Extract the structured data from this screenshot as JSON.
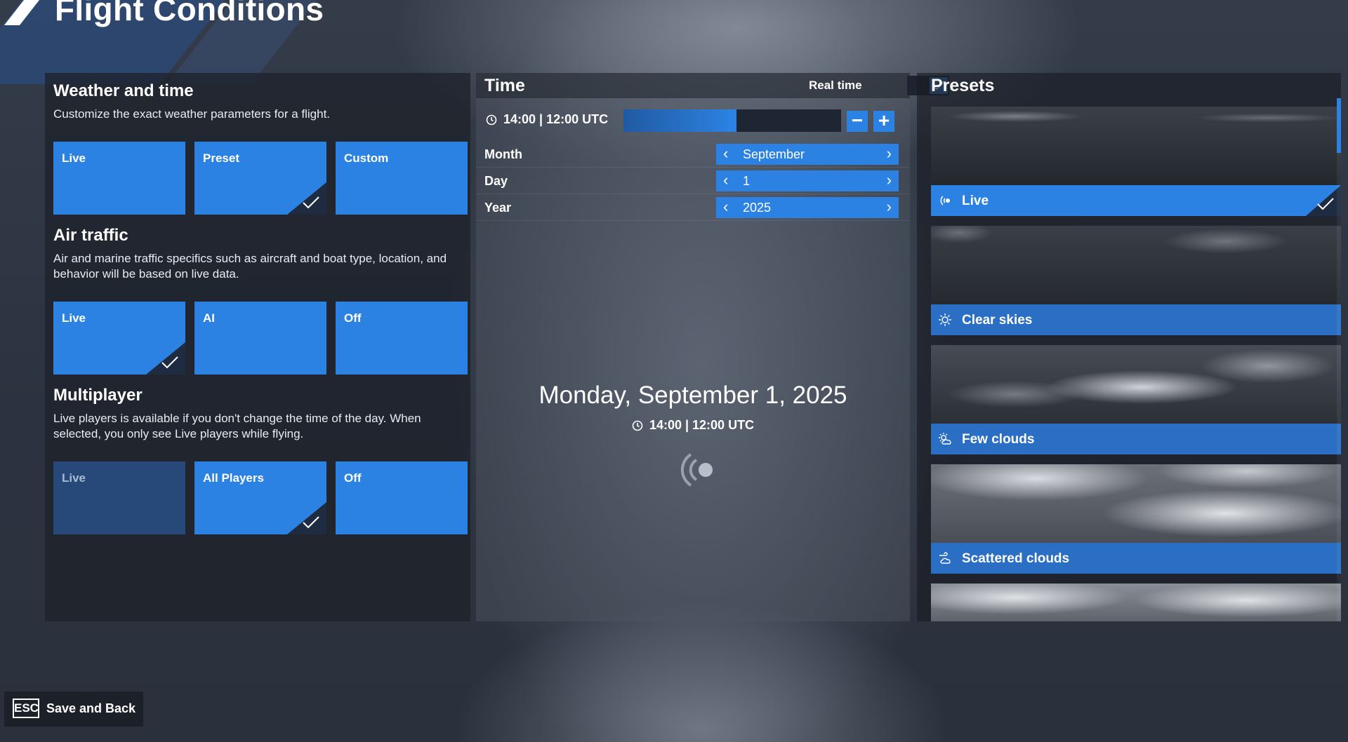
{
  "header": {
    "title": "Flight Conditions"
  },
  "weather": {
    "title": "Weather and time",
    "desc": "Customize the exact weather parameters for a flight.",
    "options": [
      {
        "label": "Live",
        "selected": false
      },
      {
        "label": "Preset",
        "selected": true
      },
      {
        "label": "Custom",
        "selected": false
      }
    ]
  },
  "air_traffic": {
    "title": "Air traffic",
    "desc": "Air and marine traffic specifics such as aircraft and boat type, location, and behavior will be based on live data.",
    "options": [
      {
        "label": "Live",
        "selected": true
      },
      {
        "label": "AI",
        "selected": false
      },
      {
        "label": "Off",
        "selected": false
      }
    ]
  },
  "multiplayer": {
    "title": "Multiplayer",
    "desc": "Live players is available if you don't change the time of the day. When selected, you only see Live players while flying.",
    "options": [
      {
        "label": "Live",
        "selected": false,
        "disabled": true
      },
      {
        "label": "All Players",
        "selected": true
      },
      {
        "label": "Off",
        "selected": false
      }
    ]
  },
  "time": {
    "title": "Time",
    "realtime_label": "Real time",
    "realtime_checked": true,
    "current": "14:00 | 12:00 UTC",
    "slider_fraction": 0.5,
    "minus": "−",
    "plus": "+",
    "rows": [
      {
        "label": "Month",
        "value": "September"
      },
      {
        "label": "Day",
        "value": "1"
      },
      {
        "label": "Year",
        "value": "2025"
      }
    ],
    "full_date": "Monday, September 1, 2025",
    "full_time": "14:00 | 12:00 UTC"
  },
  "presets": {
    "title": "Presets",
    "items": [
      {
        "label": "Live",
        "icon": "live-icon",
        "active": true
      },
      {
        "label": "Clear skies",
        "icon": "sun-icon",
        "active": false
      },
      {
        "label": "Few clouds",
        "icon": "sun-cloud-icon",
        "active": false
      },
      {
        "label": "Scattered clouds",
        "icon": "wind-cloud-icon",
        "active": false
      }
    ]
  },
  "footer": {
    "esc_key": "ESC",
    "esc_label": "Save and Back"
  },
  "colors": {
    "accent": "#2b82e2",
    "selected_corner": "#1f2b40"
  }
}
